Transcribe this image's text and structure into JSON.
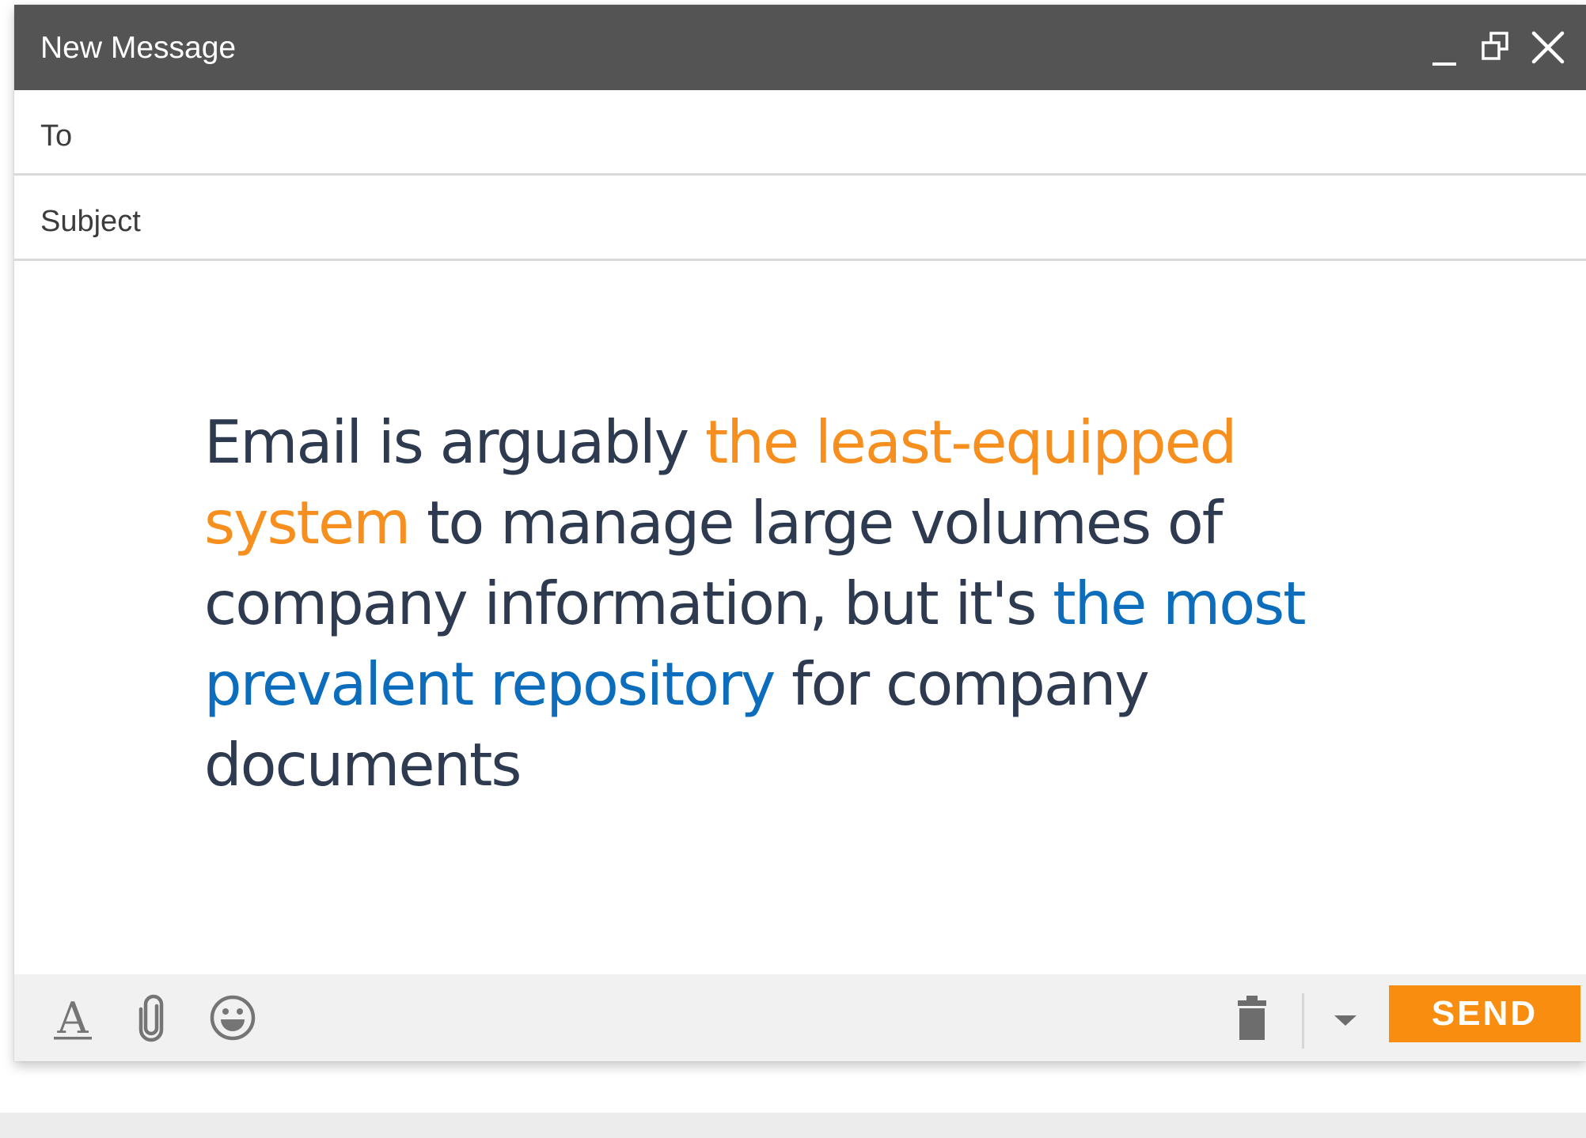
{
  "window": {
    "title": "New Message",
    "controls": [
      "minimize-icon",
      "pop-out-icon",
      "close-icon"
    ]
  },
  "fields": {
    "to": {
      "label": "To",
      "value": ""
    },
    "subject": {
      "label": "Subject",
      "value": ""
    }
  },
  "body": {
    "segments": [
      {
        "text": "Email is arguably ",
        "color": "#2d3a4f"
      },
      {
        "text": "the least-equipped system",
        "color": "#f78f1e"
      },
      {
        "text": " to manage large volumes of company information, but it's ",
        "color": "#2d3a4f"
      },
      {
        "text": "the most prevalent repository",
        "color": "#0b6dbb"
      },
      {
        "text": " for company documents",
        "color": "#2d3a4f"
      }
    ]
  },
  "toolbar": {
    "icons": [
      "format-text-icon",
      "attachment-icon",
      "emoji-icon",
      "trash-icon",
      "dropdown-arrow-icon"
    ],
    "send_label": "SEND"
  },
  "colors": {
    "title_bar": "#545454",
    "send_button": "#f88d0f",
    "highlight_orange": "#f78f1e",
    "highlight_blue": "#0b6dbb",
    "body_text": "#2d3a4f",
    "toolbar_bg": "#f1f1f1"
  }
}
